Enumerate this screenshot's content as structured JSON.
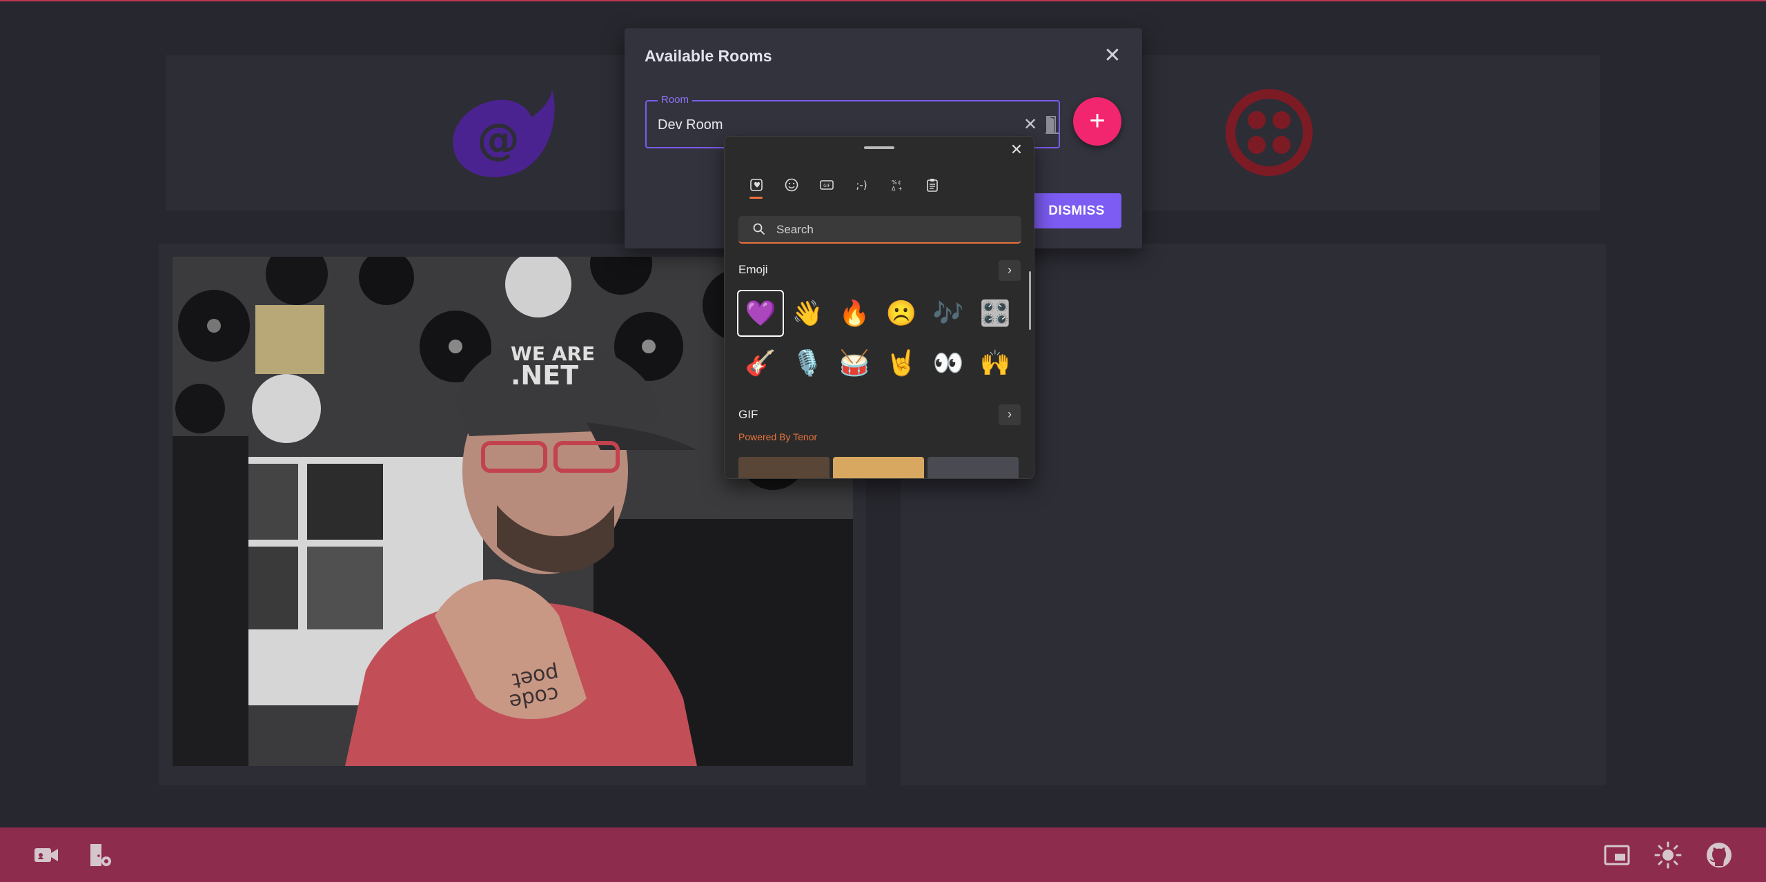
{
  "dialog": {
    "title": "Available Rooms",
    "room_label": "Room",
    "room_value": "Dev Room",
    "add_label": "+",
    "dismiss_label": "DISMISS",
    "close_glyph": "✕",
    "clear_glyph": "✕"
  },
  "picker": {
    "search_placeholder": "Search",
    "close_glyph": "✕",
    "tabs": [
      {
        "name": "recent",
        "icon": "recent-sticker-icon"
      },
      {
        "name": "emoji",
        "icon": "smiley-icon"
      },
      {
        "name": "gif",
        "label": "GIF"
      },
      {
        "name": "kaomoji",
        "label": ";-)"
      },
      {
        "name": "symbols",
        "icon": "symbols-icon"
      },
      {
        "name": "clipboard",
        "icon": "clipboard-icon"
      }
    ],
    "emoji_section_title": "Emoji",
    "gif_section_title": "GIF",
    "gif_powered_by": "Powered By Tenor",
    "arrow_glyph": "›",
    "emojis": [
      "💜",
      "👋",
      "🔥",
      "☹️",
      "🎶",
      "🎛️",
      "🎸",
      "🎙️",
      "🥁",
      "🤘",
      "👀",
      "🙌"
    ],
    "gif_thumb_colors": [
      "#5a4636",
      "#d9a860",
      "#4a4a52"
    ]
  },
  "colors": {
    "accent_purple": "#7c5cf2",
    "add_button": "#f2266e",
    "bottom_bar": "#8e2c4e",
    "picker_accent": "#e8733c",
    "twilio_red": "#8b1e29",
    "blazor_purple": "#5c2ea6"
  },
  "bottom_bar": {
    "left_icons": [
      "video-camera-icon",
      "room-settings-icon"
    ],
    "right_icons": [
      "picture-in-picture-icon",
      "brightness-icon",
      "github-icon"
    ]
  }
}
